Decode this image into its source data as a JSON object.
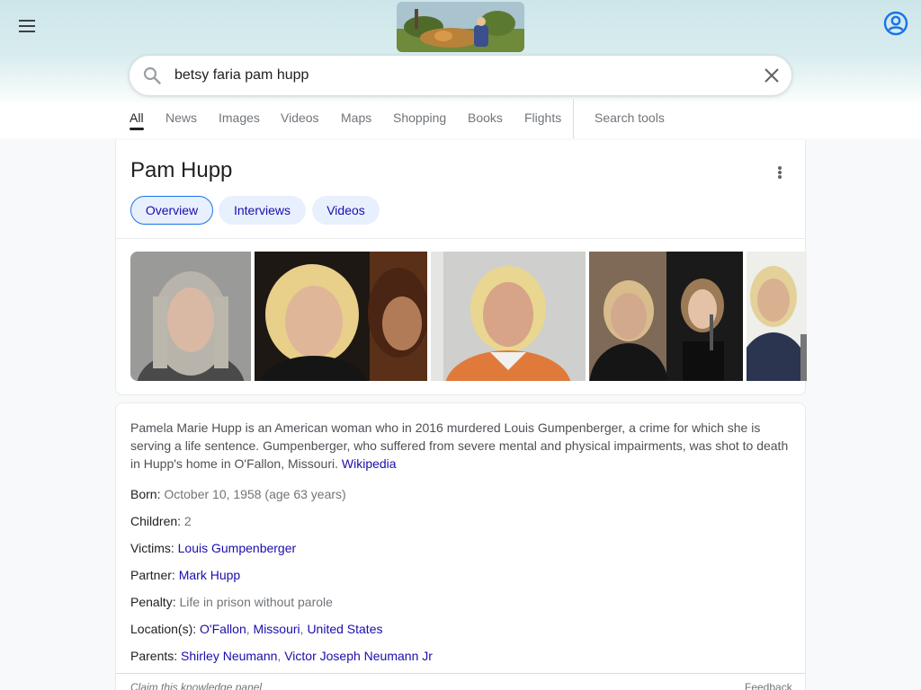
{
  "header": {
    "menu_icon": "hamburger-menu-icon",
    "doodle_icon": "doodle-image",
    "account_icon": "account-circle-icon"
  },
  "search": {
    "value": "betsy faria pam hupp",
    "search_icon": "search-icon",
    "clear_icon": "close-icon"
  },
  "tabs": {
    "items": [
      "All",
      "News",
      "Images",
      "Videos",
      "Maps",
      "Shopping",
      "Books",
      "Flights"
    ],
    "active": "All",
    "search_tools": "Search tools"
  },
  "knowledge_panel": {
    "title": "Pam Hupp",
    "chips": [
      "Overview",
      "Interviews",
      "Videos"
    ],
    "active_chip": "Overview",
    "description": "Pamela Marie Hupp is an American woman who in 2016 murdered Louis Gumpenberger, a crime for which she is serving a life sentence. Gumpenberger, who suffered from severe mental and physical impairments, was shot to death in Hupp's home in O'Fallon, Missouri.",
    "source": "Wikipedia",
    "facts": {
      "born": {
        "label": "Born:",
        "value": "October 10, 1958 (age 63 years)"
      },
      "children": {
        "label": "Children:",
        "value": "2"
      },
      "victims": {
        "label": "Victims:",
        "value": "Louis Gumpenberger"
      },
      "partner": {
        "label": "Partner:",
        "value": "Mark Hupp"
      },
      "penalty": {
        "label": "Penalty:",
        "value": "Life in prison without parole"
      },
      "locations": {
        "label": "Location(s):",
        "values": [
          "O'Fallon",
          "Missouri",
          "United States"
        ]
      },
      "parents": {
        "label": "Parents:",
        "values": [
          "Shirley Neumann",
          "Victor Joseph Neumann Jr"
        ]
      }
    },
    "claim": "Claim this knowledge panel",
    "feedback": "Feedback"
  },
  "colors": {
    "link": "#1a0dab",
    "chip_bg": "#e8f0fe",
    "chip_border": "#1a73e8",
    "header_bg": "#cde6ea"
  }
}
